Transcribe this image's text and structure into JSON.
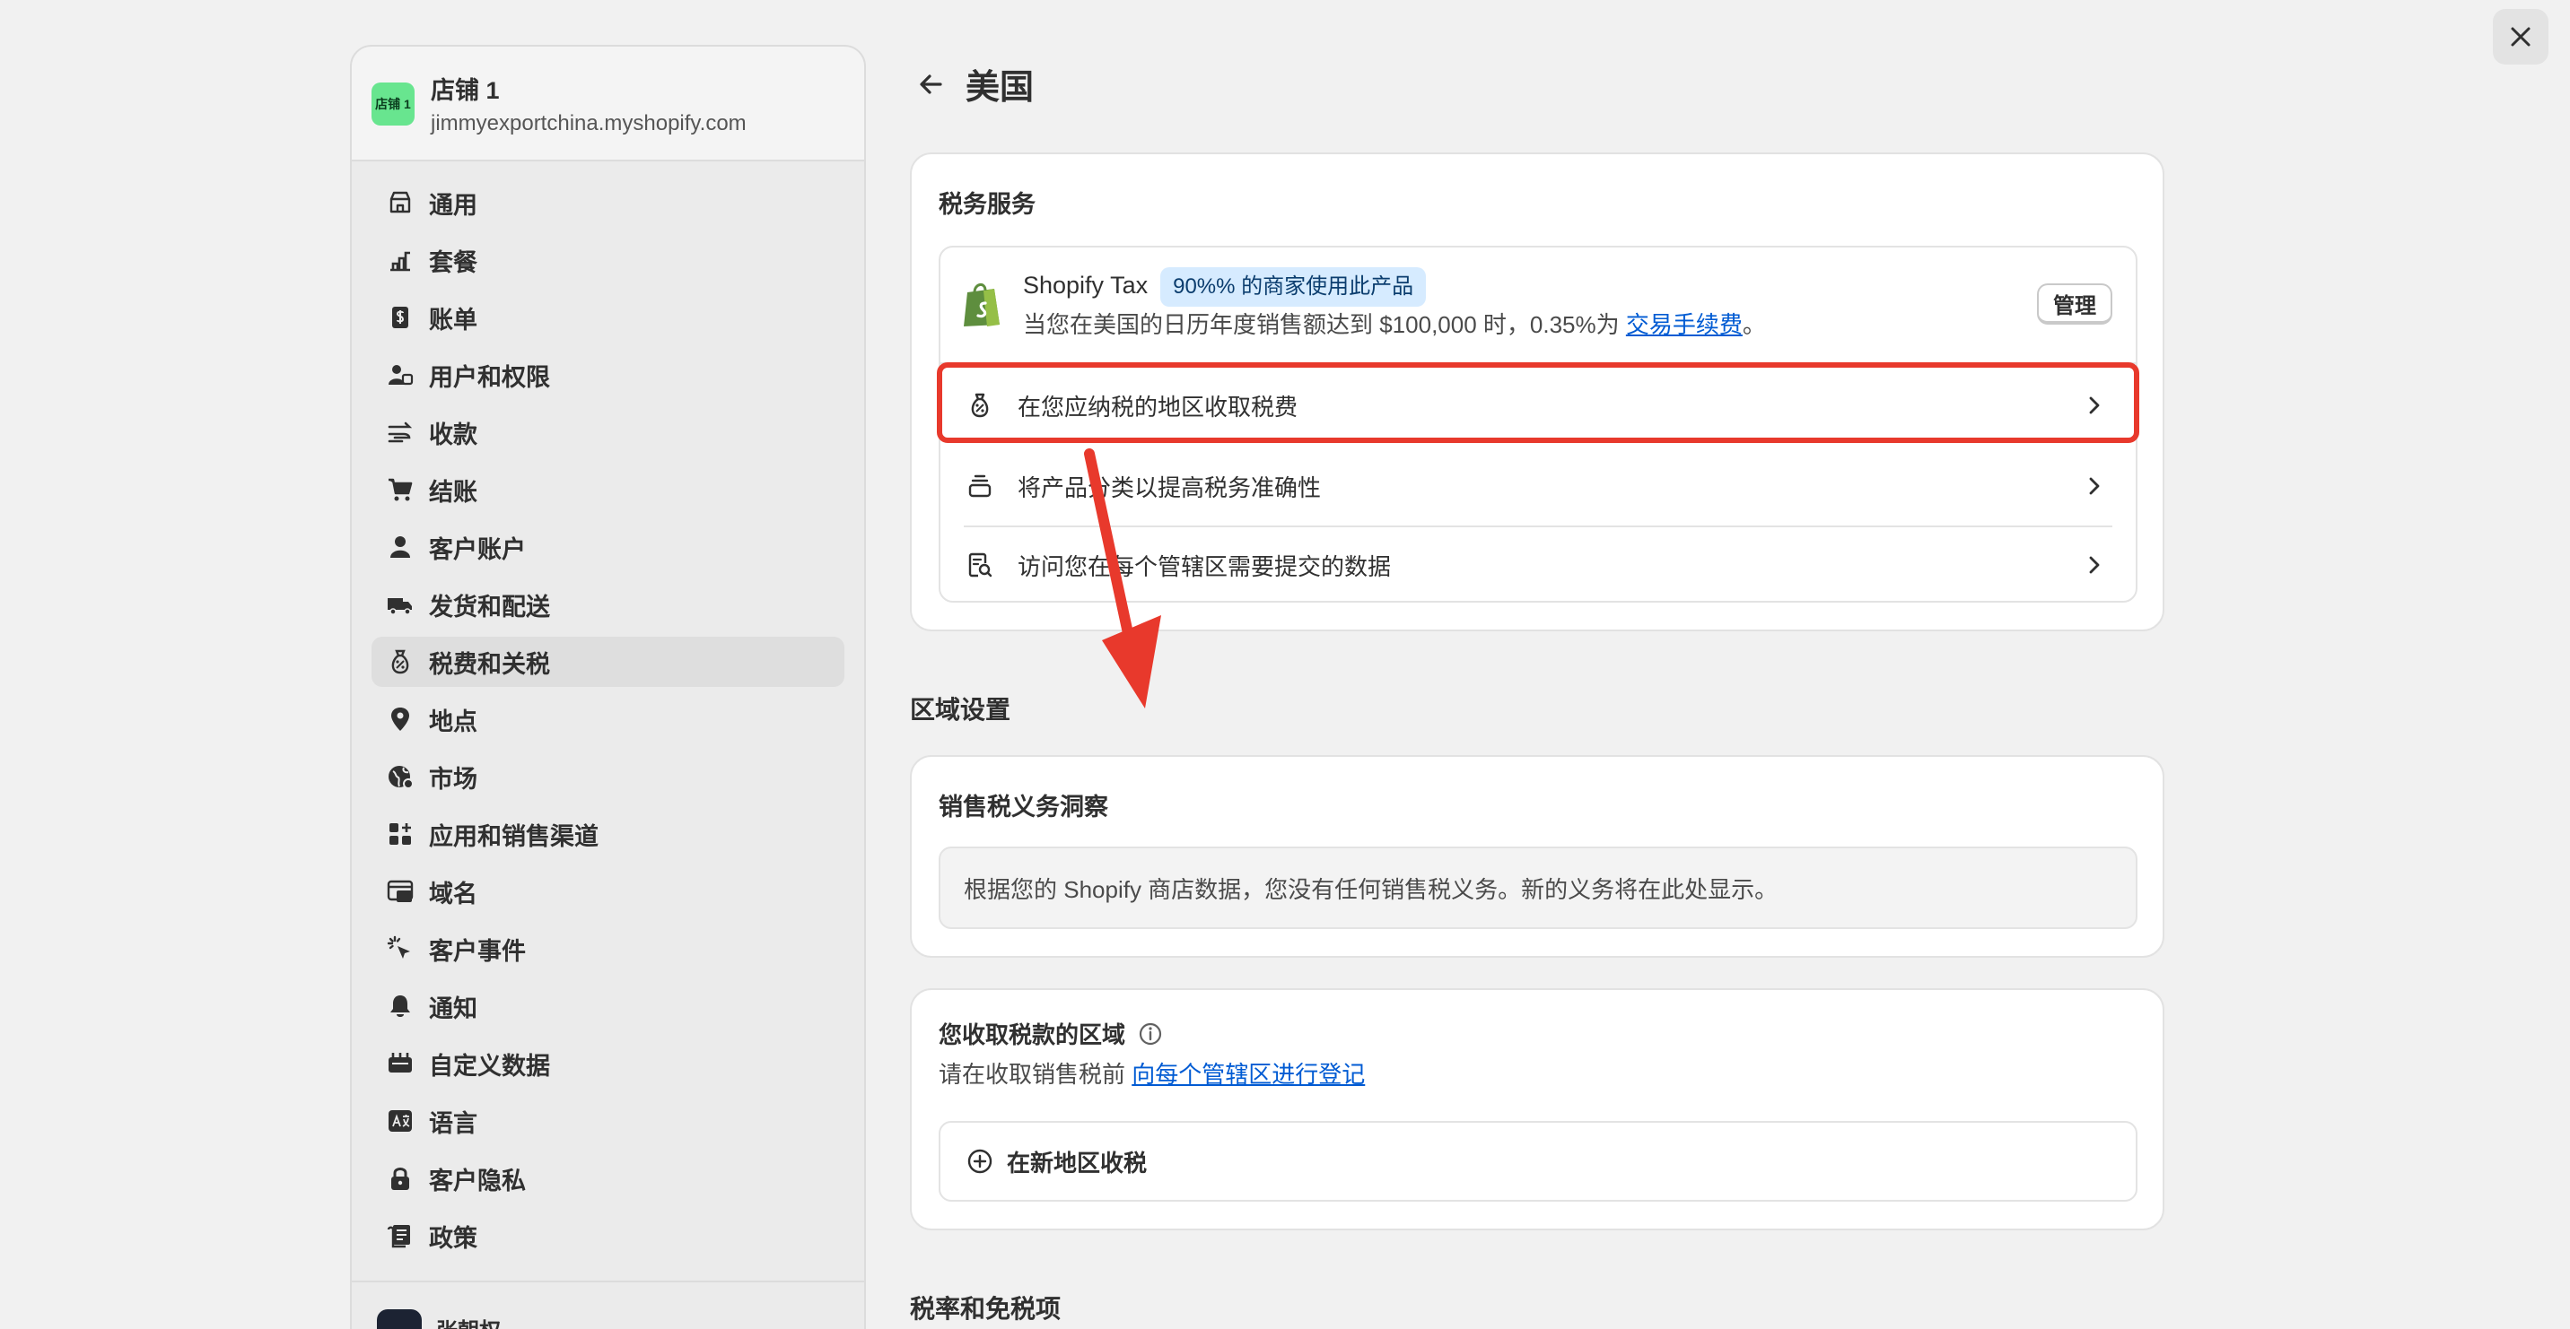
{
  "close_label": "×",
  "store": {
    "avatar_text": "店铺 1",
    "name": "店铺 1",
    "domain": "jimmyexportchina.myshopify.com"
  },
  "nav": [
    {
      "label": "通用",
      "icon": "store-icon"
    },
    {
      "label": "套餐",
      "icon": "plan-icon"
    },
    {
      "label": "账单",
      "icon": "billing-icon"
    },
    {
      "label": "用户和权限",
      "icon": "users-icon"
    },
    {
      "label": "收款",
      "icon": "payments-icon"
    },
    {
      "label": "结账",
      "icon": "cart-icon"
    },
    {
      "label": "客户账户",
      "icon": "person-icon"
    },
    {
      "label": "发货和配送",
      "icon": "truck-icon"
    },
    {
      "label": "税费和关税",
      "icon": "tax-bag-icon",
      "active": true
    },
    {
      "label": "地点",
      "icon": "location-icon"
    },
    {
      "label": "市场",
      "icon": "globe-icon"
    },
    {
      "label": "应用和销售渠道",
      "icon": "apps-icon"
    },
    {
      "label": "域名",
      "icon": "domain-icon"
    },
    {
      "label": "客户事件",
      "icon": "cursor-icon"
    },
    {
      "label": "通知",
      "icon": "bell-icon"
    },
    {
      "label": "自定义数据",
      "icon": "data-icon"
    },
    {
      "label": "语言",
      "icon": "language-icon"
    },
    {
      "label": "客户隐私",
      "icon": "lock-icon"
    },
    {
      "label": "政策",
      "icon": "policy-icon"
    }
  ],
  "user": {
    "name": "张朝权"
  },
  "page": {
    "title": "美国"
  },
  "tax_services": {
    "title": "税务服务",
    "product_name": "Shopify Tax",
    "badge": "90%% 的商家使用此产品",
    "description": "当您在美国的日历年度销售额达到 $100,000 时，0.35%为",
    "fee_link": "交易手续费",
    "description_end": "。",
    "manage_label": "管理",
    "rows": [
      {
        "label": "在您应纳税的地区收取税费"
      },
      {
        "label": "将产品分类以提高税务准确性"
      },
      {
        "label": "访问您在每个管辖区需要提交的数据"
      }
    ]
  },
  "region_settings": {
    "heading": "区域设置"
  },
  "insights": {
    "title": "销售税义务洞察",
    "message": "根据您的 Shopify 商店数据，您没有任何销售税义务。新的义务将在此处显示。"
  },
  "collect": {
    "title": "您收取税款的区域",
    "hint": "请在收取销售税前",
    "hint_link": "向每个管辖区进行登记",
    "add_label": "在新地区收税"
  },
  "rates": {
    "heading": "税率和免税项"
  },
  "colors": {
    "accent": "#005bd3",
    "highlight": "#e8392c",
    "badge_bg": "#d6ebff",
    "avatar": "#68e58f"
  }
}
